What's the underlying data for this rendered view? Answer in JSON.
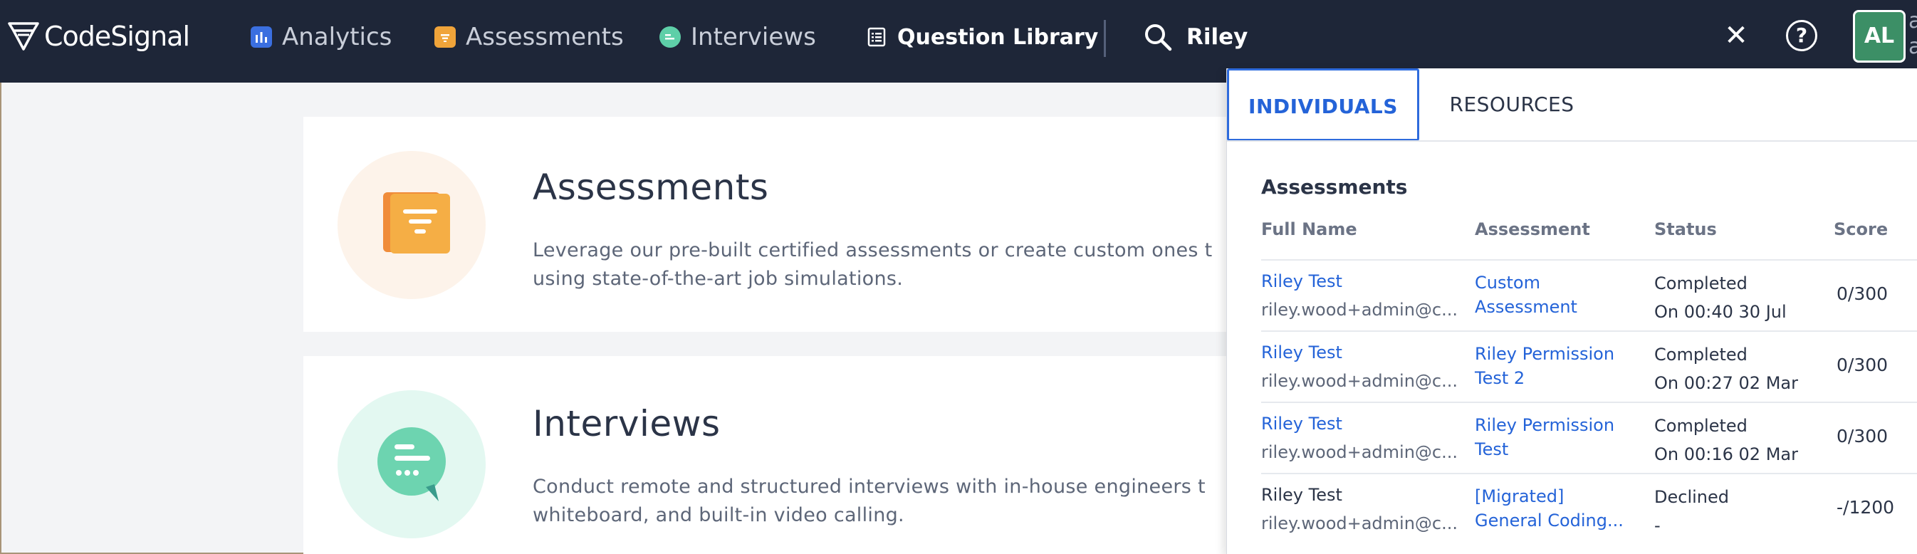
{
  "brand": {
    "name": "CodeSignal"
  },
  "nav": {
    "items": [
      {
        "label": "Analytics",
        "icon": "bar-chart-icon",
        "color": "#3b6fe0"
      },
      {
        "label": "Assessments",
        "icon": "document-icon",
        "color": "#f0a43a"
      },
      {
        "label": "Interviews",
        "icon": "chat-icon",
        "color": "#5ecfa8"
      },
      {
        "label": "Question Library",
        "icon": "list-icon",
        "color": "#ffffff"
      }
    ]
  },
  "search": {
    "value": "Riley"
  },
  "user": {
    "initials": "AL",
    "name_clip": "a\na"
  },
  "cards": [
    {
      "title": "Assessments",
      "description_line1": "Leverage our pre-built certified assessments or create custom ones t",
      "description_line2": "using state-of-the-art job simulations."
    },
    {
      "title": "Interviews",
      "description_line1": "Conduct remote and structured interviews with in-house engineers t",
      "description_line2": "whiteboard, and built-in video calling."
    }
  ],
  "results": {
    "tabs": [
      "INDIVIDUALS",
      "RESOURCES"
    ],
    "active_tab": "INDIVIDUALS",
    "section_title": "Assessments",
    "columns": [
      "Full Name",
      "Assessment",
      "Status",
      "Score"
    ],
    "rows": [
      {
        "name": "Riley Test",
        "email": "riley.wood+admin@c...",
        "assessment_line1": "Custom",
        "assessment_line2": "Assessment",
        "status": "Completed",
        "status_detail": "On 00:40 30 Jul",
        "score": "0/300"
      },
      {
        "name": "Riley Test",
        "email": "riley.wood+admin@c...",
        "assessment_line1": "Riley Permission",
        "assessment_line2": "Test 2",
        "status": "Completed",
        "status_detail": "On 00:27 02 Mar",
        "score": "0/300"
      },
      {
        "name": "Riley Test",
        "email": "riley.wood+admin@c...",
        "assessment_line1": "Riley Permission",
        "assessment_line2": "Test",
        "status": "Completed",
        "status_detail": "On 00:16 02 Mar",
        "score": "0/300"
      },
      {
        "name": "Riley Test",
        "email": "riley.wood+admin@c...",
        "assessment_line1": "[Migrated]",
        "assessment_line2": "General Coding...",
        "status": "Declined",
        "status_detail": "-",
        "score": "-/1200"
      }
    ]
  }
}
